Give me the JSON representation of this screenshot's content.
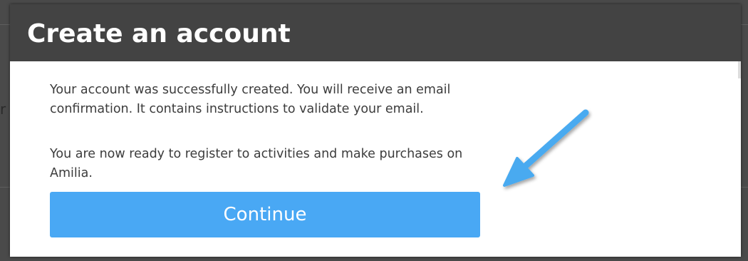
{
  "dialog": {
    "title": "Create an account",
    "message_paragraphs": [
      "Your account was successfully created. You will receive an email confirmation. It contains instructions to validate your email.",
      "You are now ready to register to activities and make purchases on Amilia."
    ],
    "continue_label": "Continue"
  },
  "colors": {
    "header_background": "#434343",
    "button_background": "#49a8f4",
    "callout_arrow": "#4aaaf0",
    "body_text": "#3c3c3c"
  },
  "annotation": {
    "icon": "arrow-pointing-down-left-icon"
  }
}
